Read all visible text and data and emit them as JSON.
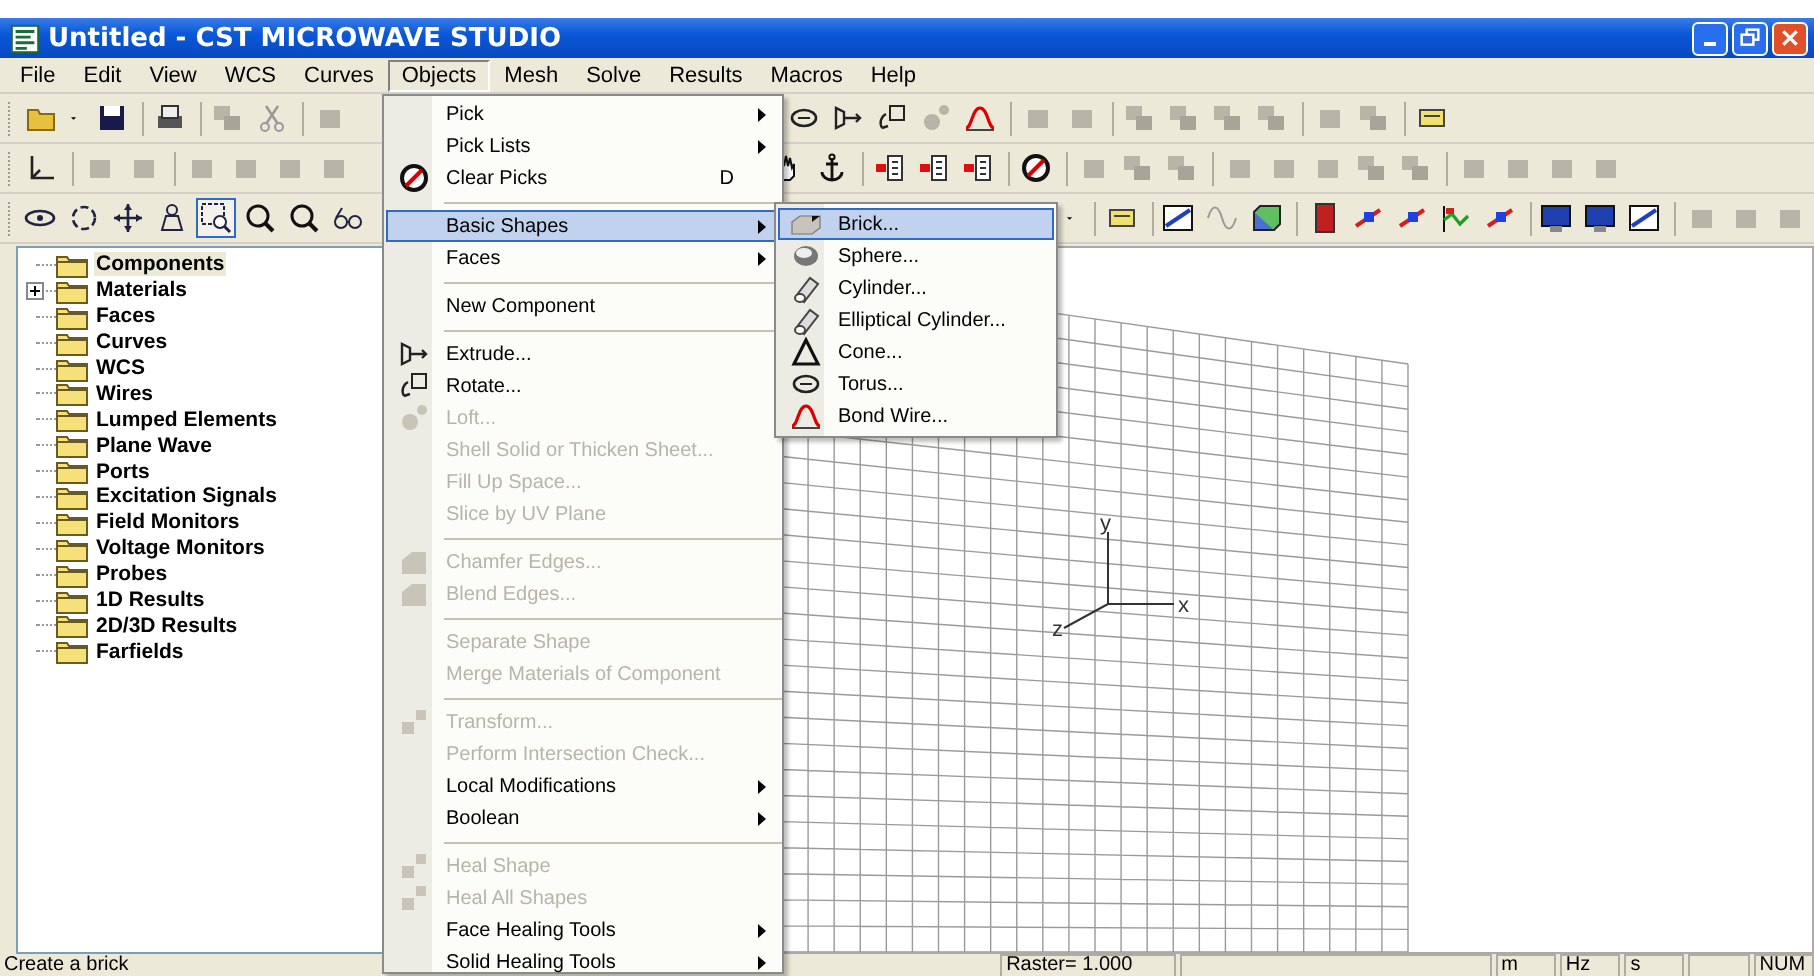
{
  "window": {
    "title": "Untitled - CST MICROWAVE STUDIO"
  },
  "menu_bar": [
    {
      "label": "File",
      "selected": false
    },
    {
      "label": "Edit",
      "selected": false
    },
    {
      "label": "View",
      "selected": false
    },
    {
      "label": "WCS",
      "selected": false
    },
    {
      "label": "Curves",
      "selected": false
    },
    {
      "label": "Objects",
      "selected": true
    },
    {
      "label": "Mesh",
      "selected": false
    },
    {
      "label": "Solve",
      "selected": false
    },
    {
      "label": "Results",
      "selected": false
    },
    {
      "label": "Macros",
      "selected": false
    },
    {
      "label": "Help",
      "selected": false
    }
  ],
  "tree": [
    {
      "label": "Components",
      "selected": true,
      "expandable": false
    },
    {
      "label": "Materials",
      "selected": false,
      "expandable": true
    },
    {
      "label": "Faces",
      "selected": false,
      "expandable": false
    },
    {
      "label": "Curves",
      "selected": false,
      "expandable": false
    },
    {
      "label": "WCS",
      "selected": false,
      "expandable": false
    },
    {
      "label": "Wires",
      "selected": false,
      "expandable": false
    },
    {
      "label": "Lumped Elements",
      "selected": false,
      "expandable": false
    },
    {
      "label": "Plane Wave",
      "selected": false,
      "expandable": false
    },
    {
      "label": "Ports",
      "selected": false,
      "expandable": false
    },
    {
      "label": "Excitation Signals",
      "selected": false,
      "expandable": false
    },
    {
      "label": "Field Monitors",
      "selected": false,
      "expandable": false
    },
    {
      "label": "Voltage Monitors",
      "selected": false,
      "expandable": false
    },
    {
      "label": "Probes",
      "selected": false,
      "expandable": false
    },
    {
      "label": "1D Results",
      "selected": false,
      "expandable": false
    },
    {
      "label": "2D/3D Results",
      "selected": false,
      "expandable": false
    },
    {
      "label": "Farfields",
      "selected": false,
      "expandable": false
    }
  ],
  "objects_menu": [
    {
      "kind": "item",
      "label": "Pick",
      "submenu": true,
      "disabled": false,
      "selected": false
    },
    {
      "kind": "item",
      "label": "Pick Lists",
      "submenu": true,
      "disabled": false,
      "selected": false
    },
    {
      "kind": "item",
      "label": "Clear Picks",
      "shortcut": "D",
      "submenu": false,
      "disabled": false,
      "selected": false
    },
    {
      "kind": "separator"
    },
    {
      "kind": "item",
      "label": "Basic Shapes",
      "submenu": true,
      "disabled": false,
      "selected": true
    },
    {
      "kind": "item",
      "label": "Faces",
      "submenu": true,
      "disabled": false,
      "selected": false
    },
    {
      "kind": "separator"
    },
    {
      "kind": "item",
      "label": "New Component",
      "submenu": false,
      "disabled": false,
      "selected": false
    },
    {
      "kind": "separator"
    },
    {
      "kind": "item",
      "label": "Extrude...",
      "submenu": false,
      "disabled": false,
      "selected": false
    },
    {
      "kind": "item",
      "label": "Rotate...",
      "submenu": false,
      "disabled": false,
      "selected": false
    },
    {
      "kind": "item",
      "label": "Loft...",
      "submenu": false,
      "disabled": true,
      "selected": false
    },
    {
      "kind": "item",
      "label": "Shell Solid or Thicken Sheet...",
      "submenu": false,
      "disabled": true,
      "selected": false
    },
    {
      "kind": "item",
      "label": "Fill Up Space...",
      "submenu": false,
      "disabled": true,
      "selected": false
    },
    {
      "kind": "item",
      "label": "Slice by UV Plane",
      "submenu": false,
      "disabled": true,
      "selected": false
    },
    {
      "kind": "separator"
    },
    {
      "kind": "item",
      "label": "Chamfer Edges...",
      "submenu": false,
      "disabled": true,
      "selected": false
    },
    {
      "kind": "item",
      "label": "Blend Edges...",
      "submenu": false,
      "disabled": true,
      "selected": false
    },
    {
      "kind": "separator"
    },
    {
      "kind": "item",
      "label": "Separate Shape",
      "submenu": false,
      "disabled": true,
      "selected": false
    },
    {
      "kind": "item",
      "label": "Merge Materials of Component",
      "submenu": false,
      "disabled": true,
      "selected": false
    },
    {
      "kind": "separator"
    },
    {
      "kind": "item",
      "label": "Transform...",
      "submenu": false,
      "disabled": true,
      "selected": false
    },
    {
      "kind": "item",
      "label": "Perform Intersection Check...",
      "submenu": false,
      "disabled": true,
      "selected": false
    },
    {
      "kind": "item",
      "label": "Local Modifications",
      "submenu": true,
      "disabled": false,
      "selected": false
    },
    {
      "kind": "item",
      "label": "Boolean",
      "submenu": true,
      "disabled": false,
      "selected": false
    },
    {
      "kind": "separator"
    },
    {
      "kind": "item",
      "label": "Heal Shape",
      "submenu": false,
      "disabled": true,
      "selected": false
    },
    {
      "kind": "item",
      "label": "Heal All Shapes",
      "submenu": false,
      "disabled": true,
      "selected": false
    },
    {
      "kind": "item",
      "label": "Face Healing Tools",
      "submenu": true,
      "disabled": false,
      "selected": false
    },
    {
      "kind": "item",
      "label": "Solid Healing Tools",
      "submenu": true,
      "disabled": false,
      "selected": false
    }
  ],
  "basic_shapes_menu": [
    {
      "label": "Brick...",
      "selected": true
    },
    {
      "label": "Sphere...",
      "selected": false
    },
    {
      "label": "Cylinder...",
      "selected": false
    },
    {
      "label": "Elliptical Cylinder...",
      "selected": false
    },
    {
      "label": "Cone...",
      "selected": false
    },
    {
      "label": "Torus...",
      "selected": false
    },
    {
      "label": "Bond Wire...",
      "selected": false
    }
  ],
  "view": {
    "axis_labels": [
      "y",
      "x",
      "z"
    ]
  },
  "status_bar": {
    "message": "Create a brick",
    "raster": "Raster=  1.000",
    "units": [
      "m",
      "Hz",
      "s"
    ],
    "indicator": "NUM"
  }
}
